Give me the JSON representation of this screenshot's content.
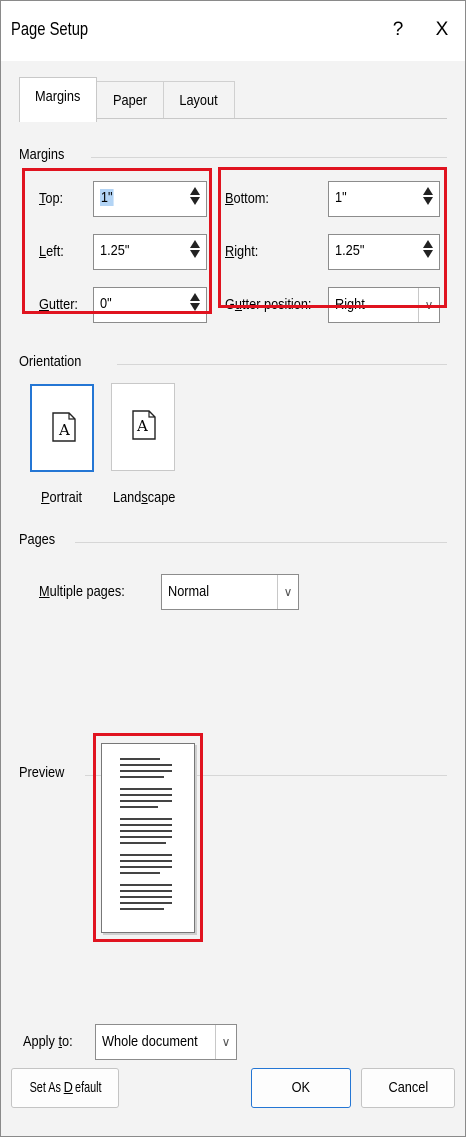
{
  "dialog": {
    "title": "Page Setup",
    "help": "?",
    "close": "X"
  },
  "tabs": [
    {
      "label": "Margins",
      "active": true
    },
    {
      "label": "Paper",
      "active": false
    },
    {
      "label": "Layout",
      "active": false
    }
  ],
  "margins": {
    "group_label": "Margins",
    "top": {
      "label_key": "T",
      "label_rest": "op:",
      "value": "1\""
    },
    "left": {
      "label_key": "L",
      "label_rest": "eft:",
      "value": "1.25\""
    },
    "gutter": {
      "label_key": "G",
      "label_rest": "utter:",
      "value": "0\""
    },
    "bottom": {
      "label_key": "B",
      "label_rest": "ottom:",
      "value": "1\""
    },
    "right": {
      "label_key": "R",
      "label_rest": "ight:",
      "value": "1.25\""
    },
    "gutter_position": {
      "label_pre": "G",
      "label_key": "u",
      "label_rest": "tter position:",
      "value": "Right"
    }
  },
  "orientation": {
    "group_label": "Orientation",
    "portrait": {
      "label_key": "P",
      "label_rest": "ortrait",
      "glyph": "A"
    },
    "landscape": {
      "label_pre": "Land",
      "label_key": "s",
      "label_rest": "cape",
      "glyph": "A"
    }
  },
  "pages": {
    "group_label": "Pages",
    "multiple_pages": {
      "label_key": "M",
      "label_rest": "ultiple pages:",
      "value": "Normal"
    }
  },
  "preview": {
    "group_label": "Preview"
  },
  "apply_to": {
    "label_pre": "Apply ",
    "label_key": "t",
    "label_rest": "o:",
    "value": "Whole document"
  },
  "buttons": {
    "set_default_pre": "Set As ",
    "set_default_key": "D",
    "set_default_rest": "efault",
    "ok": "OK",
    "cancel": "Cancel"
  },
  "colors": {
    "highlight": "#e0131f",
    "accent": "#2476d4",
    "selection": "#b3d4f5"
  },
  "icons": {
    "help": "question-mark-icon",
    "close": "close-icon",
    "spin": "spin-arrows-icon",
    "dropdown": "chevron-down-icon",
    "portrait": "portrait-page-icon",
    "landscape": "landscape-page-icon"
  }
}
